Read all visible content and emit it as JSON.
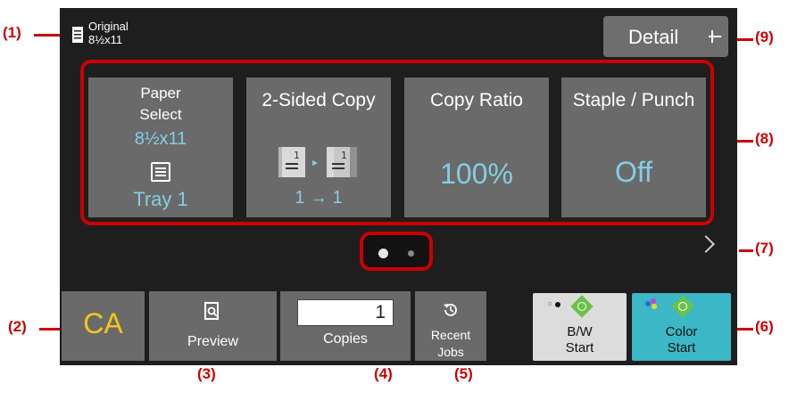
{
  "callouts": [
    "(1)",
    "(2)",
    "(3)",
    "(4)",
    "(5)",
    "(6)",
    "(7)",
    "(8)",
    "(9)"
  ],
  "original": {
    "label": "Original",
    "size": "8½x11",
    "icon": "document-icon"
  },
  "detail_button": {
    "label": "Detail",
    "icon": "pin-icon"
  },
  "tiles": [
    {
      "title": "Paper Select",
      "value": "8½x11",
      "sub_value": "Tray 1",
      "icon": "paper-tray-icon"
    },
    {
      "title": "2-Sided Copy",
      "value": "1 → 1",
      "icon": "duplex-copy-icon"
    },
    {
      "title": "Copy Ratio",
      "value": "100%"
    },
    {
      "title": "Staple / Punch",
      "value": "Off"
    }
  ],
  "page_indicator": {
    "pages": 2,
    "current": 1
  },
  "next_icon": "chevron-right-icon",
  "bottom": {
    "ca": "CA",
    "preview": {
      "label": "Preview",
      "icon": "preview-icon"
    },
    "copies": {
      "value": "1",
      "label": "Copies"
    },
    "recent_jobs": {
      "label": "Recent Jobs",
      "icon": "history-icon"
    },
    "bw_start": {
      "label": "B/W Start",
      "icon": "start-icon"
    },
    "color_start": {
      "label": "Color Start",
      "icon": "start-icon"
    }
  },
  "colors": {
    "accent_value": "#86cde3",
    "ca": "#f3c819",
    "callout": "#cc0000",
    "color_start_bg": "#3bb7c5",
    "start_diamond": "#6bc24a"
  }
}
